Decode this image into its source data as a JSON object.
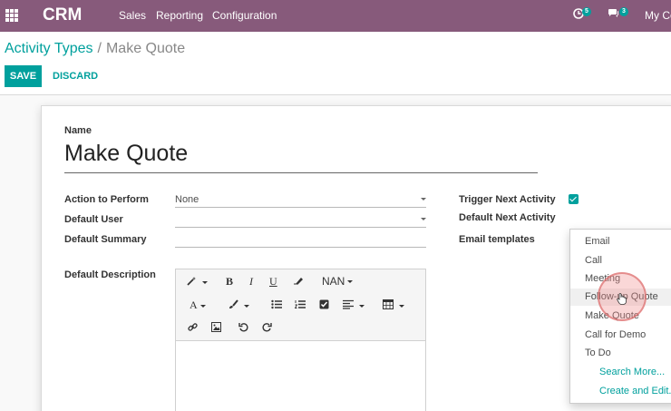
{
  "topbar": {
    "brand": "CRM",
    "menu": [
      "Sales",
      "Reporting",
      "Configuration"
    ],
    "activity_badge": "5",
    "messages_badge": "3",
    "company": "My Co"
  },
  "breadcrumb": {
    "parent": "Activity Types",
    "separator": "/",
    "current": "Make Quote"
  },
  "buttons": {
    "save": "SAVE",
    "discard": "DISCARD"
  },
  "form": {
    "name_label": "Name",
    "name_value": "Make Quote",
    "action_label": "Action to Perform",
    "action_value": "None",
    "default_user_label": "Default User",
    "default_user_value": "",
    "default_summary_label": "Default Summary",
    "default_summary_value": "",
    "default_description_label": "Default Description",
    "trigger_next_label": "Trigger Next Activity",
    "trigger_next_checked": true,
    "default_next_label": "Default Next Activity",
    "email_templates_label": "Email templates"
  },
  "editor_toolbar": {
    "font_size": "NAN",
    "bold": "B",
    "italic": "I",
    "underline": "U",
    "text_color": "A"
  },
  "dropdown": {
    "options": [
      "Email",
      "Call",
      "Meeting",
      "Follow-up Quote",
      "Make Quote",
      "Call for Demo",
      "To Do"
    ],
    "highlighted": "Follow-up Quote",
    "search_more": "Search More...",
    "create_edit": "Create and Edit..."
  },
  "colors": {
    "nav": "#875a7b",
    "accent": "#00a09d"
  }
}
